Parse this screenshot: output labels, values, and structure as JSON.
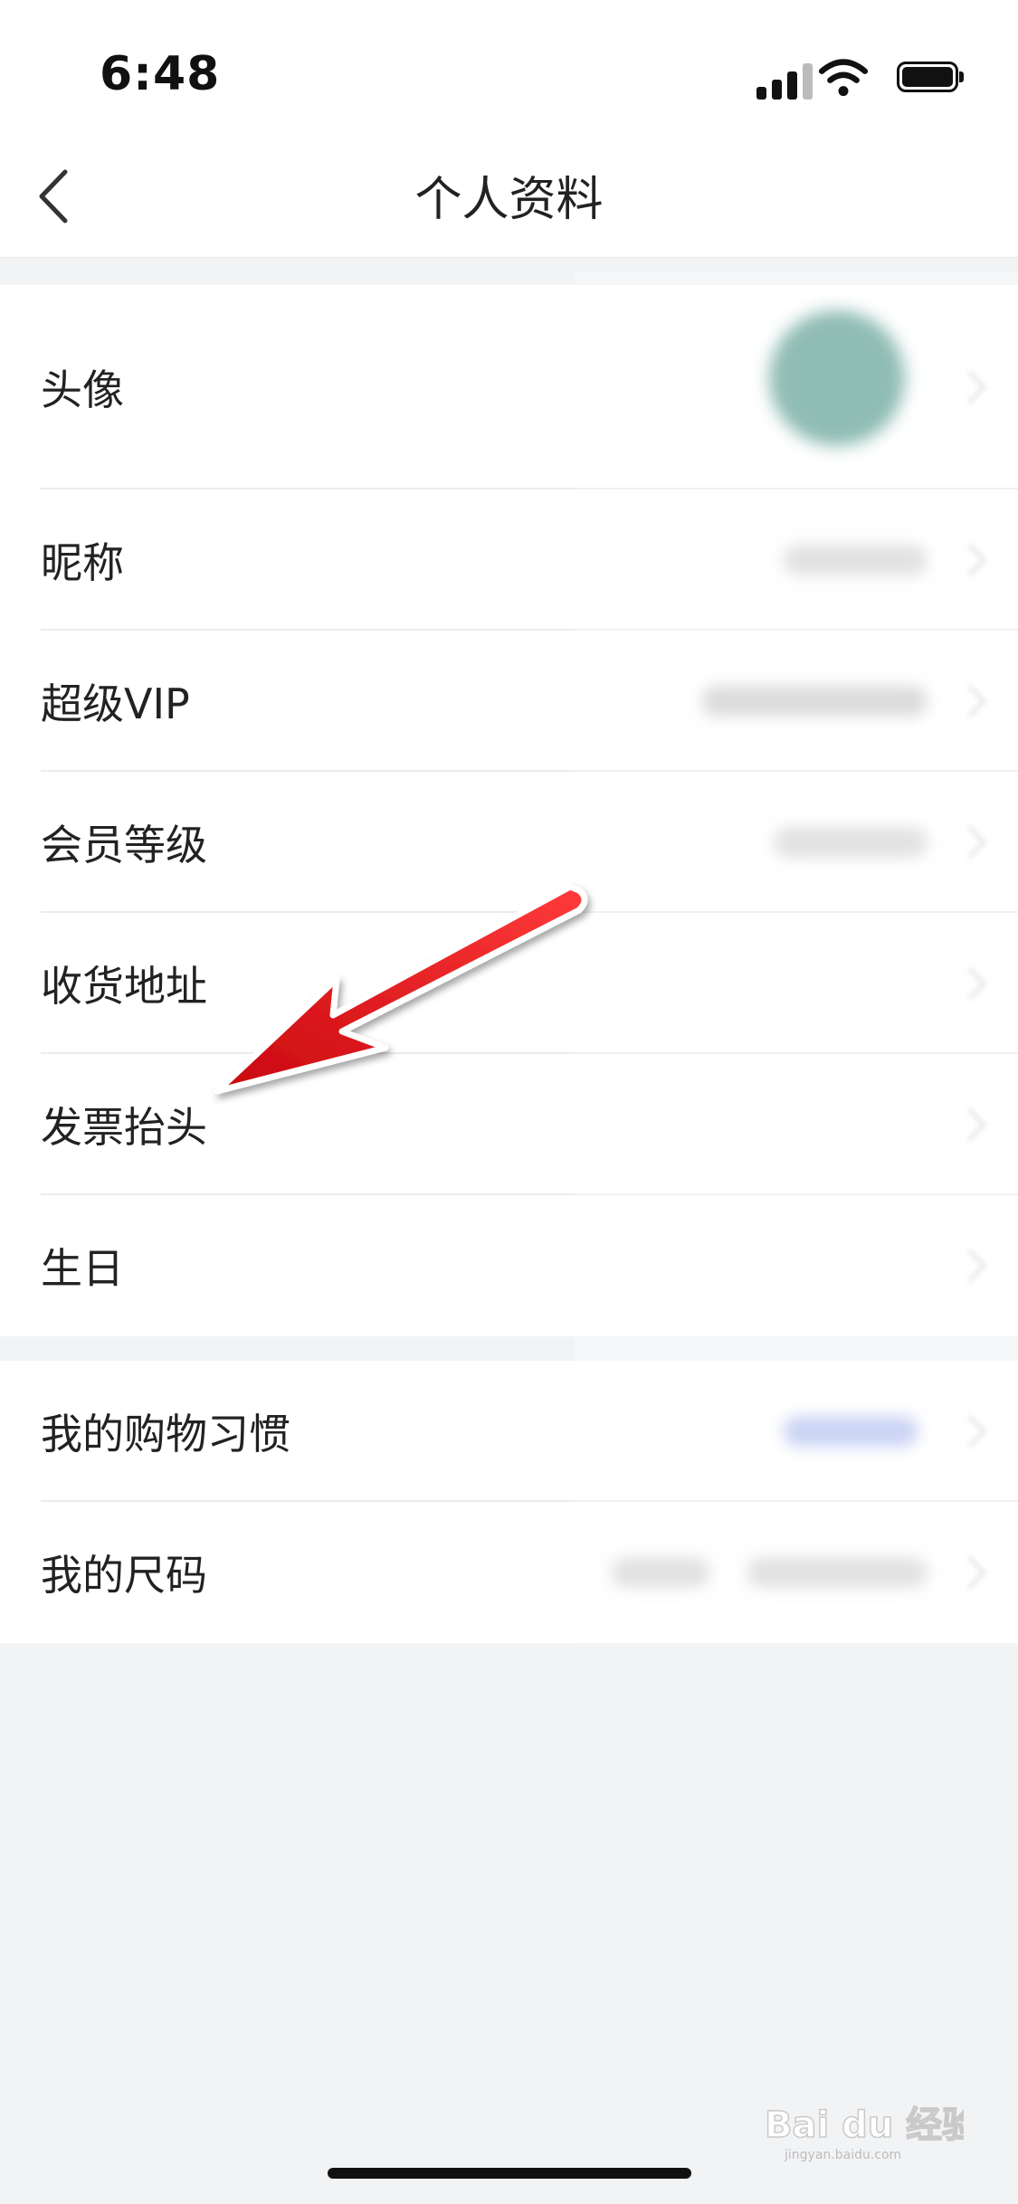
{
  "status_bar": {
    "time": "6:48"
  },
  "header": {
    "title": "个人资料",
    "back_icon": "chevron-left-icon"
  },
  "profile_rows": [
    {
      "label": "头像"
    },
    {
      "label": "昵称"
    },
    {
      "label": "超级VIP"
    },
    {
      "label": "会员等级"
    },
    {
      "label": "收货地址"
    },
    {
      "label": "发票抬头"
    },
    {
      "label": "生日"
    }
  ],
  "preference_rows": [
    {
      "label": "我的购物习惯"
    },
    {
      "label": "我的尺码"
    }
  ],
  "colors": {
    "accent_arrow": "#e3141b",
    "avatar_blur": "#6aa69a",
    "page_bg": "#f2f3f5"
  },
  "watermark": {
    "text": "Bai du 经验",
    "subtext": "jingyan.baidu.com"
  }
}
